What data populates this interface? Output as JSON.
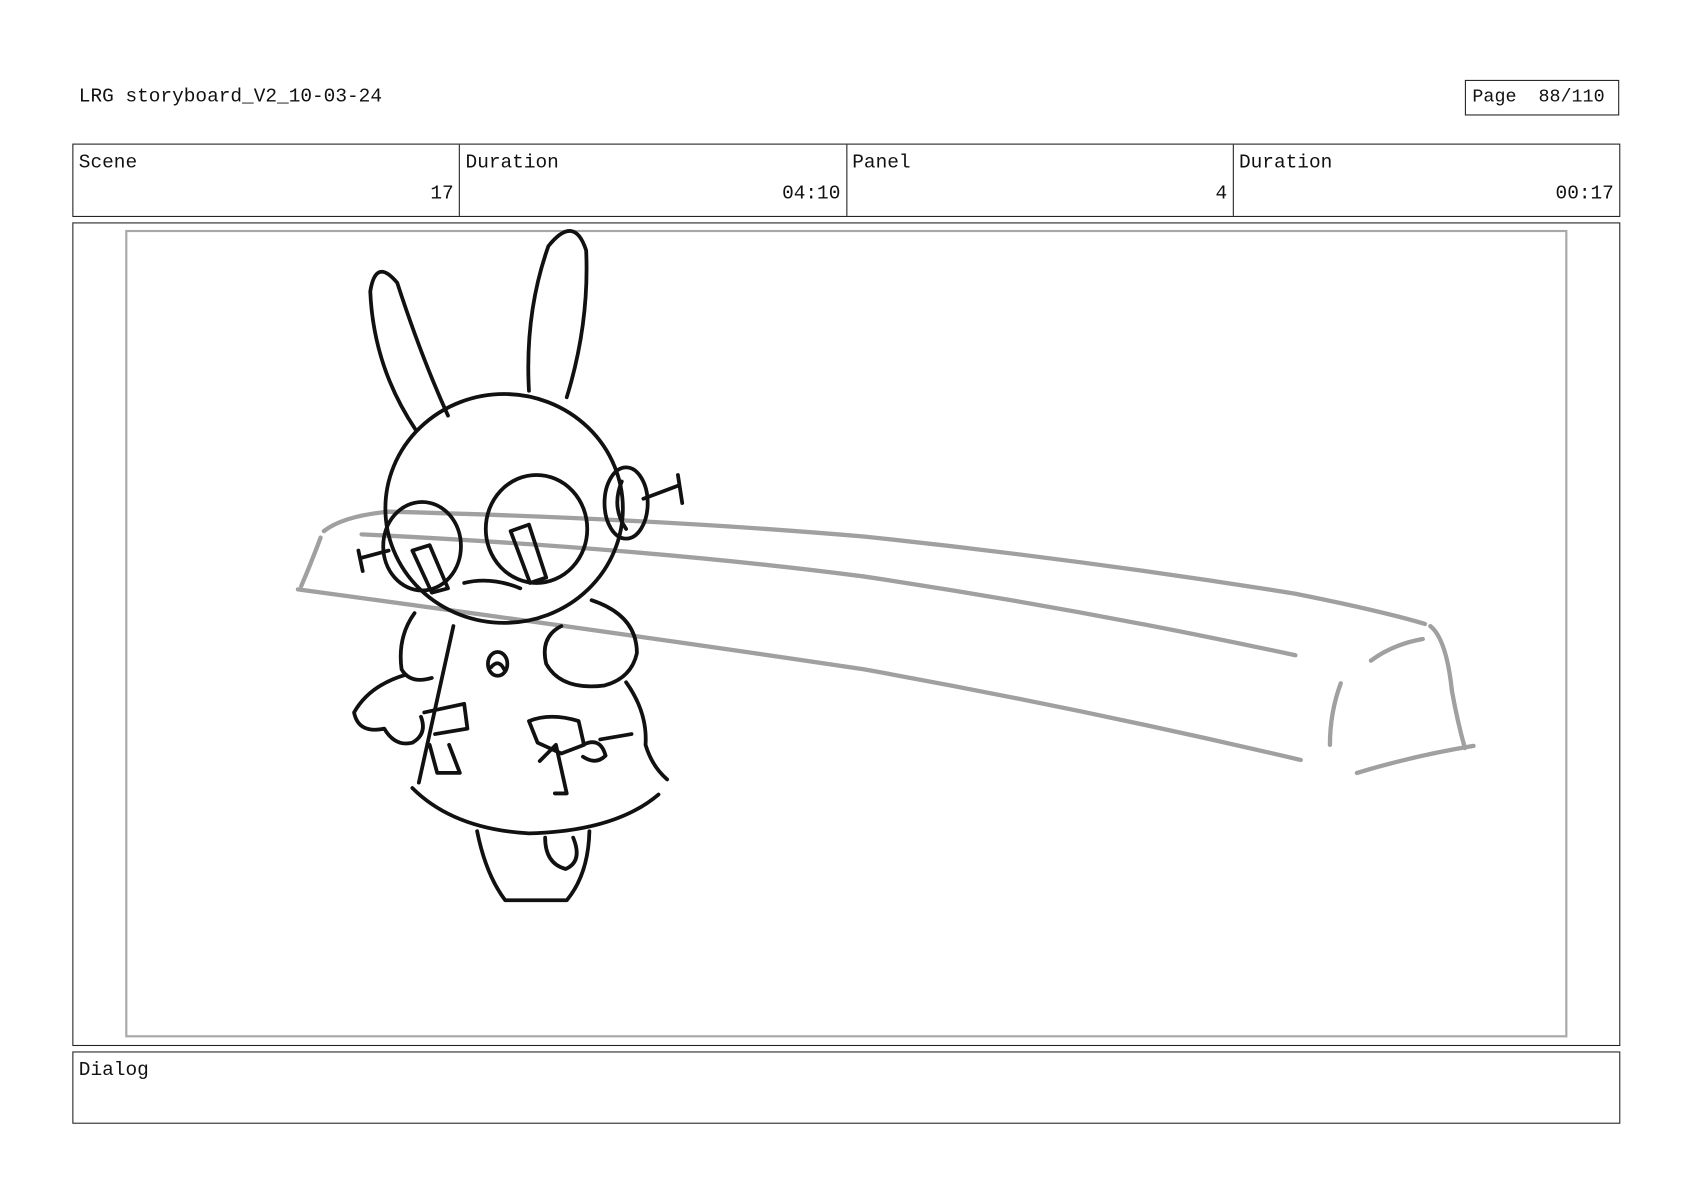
{
  "header": {
    "title": "LRG storyboard_V2_10-03-24",
    "page_label": "Page",
    "page_value": "88/110"
  },
  "info": {
    "scene_label": "Scene",
    "scene_value": "17",
    "scene_duration_label": "Duration",
    "scene_duration_value": "04:10",
    "panel_label": "Panel",
    "panel_value": "4",
    "panel_duration_label": "Duration",
    "panel_duration_value": "00:17"
  },
  "dialog": {
    "label": "Dialog",
    "text": ""
  },
  "colors": {
    "character_stroke": "#111111",
    "background_stroke": "#a0a0a0",
    "frame_border": "#a8a8a8"
  }
}
